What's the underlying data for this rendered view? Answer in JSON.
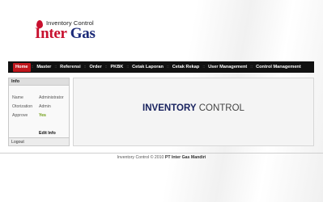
{
  "logo": {
    "small_text": "Inventory Control",
    "brand_first": "Inter",
    "brand_rest": " Gas",
    "drop_color": "#c8102e"
  },
  "nav": {
    "items": [
      {
        "label": "Home",
        "active": true
      },
      {
        "label": "Master"
      },
      {
        "label": "Referensi"
      },
      {
        "label": "Order"
      },
      {
        "label": "PKBK"
      },
      {
        "label": "Cetak Laporan"
      },
      {
        "label": "Cetak Rekap"
      },
      {
        "label": "User Management"
      },
      {
        "label": "Control Management"
      }
    ],
    "active_color": "#c0161c"
  },
  "sidebar": {
    "title": "Info",
    "rows": [
      {
        "label": "Name",
        "value": "Administrator"
      },
      {
        "label": "Otorization",
        "value": "Admin"
      },
      {
        "label": "Approve",
        "value": "Yes"
      }
    ],
    "edit_label": "Edit Info",
    "logout_label": "Logout"
  },
  "main": {
    "title_word1": "INVENTORY",
    "title_word2": "CONTROL"
  },
  "footer": {
    "text": "Inventory Control © 2010",
    "company": "PT Inter Gas Mandiri"
  }
}
